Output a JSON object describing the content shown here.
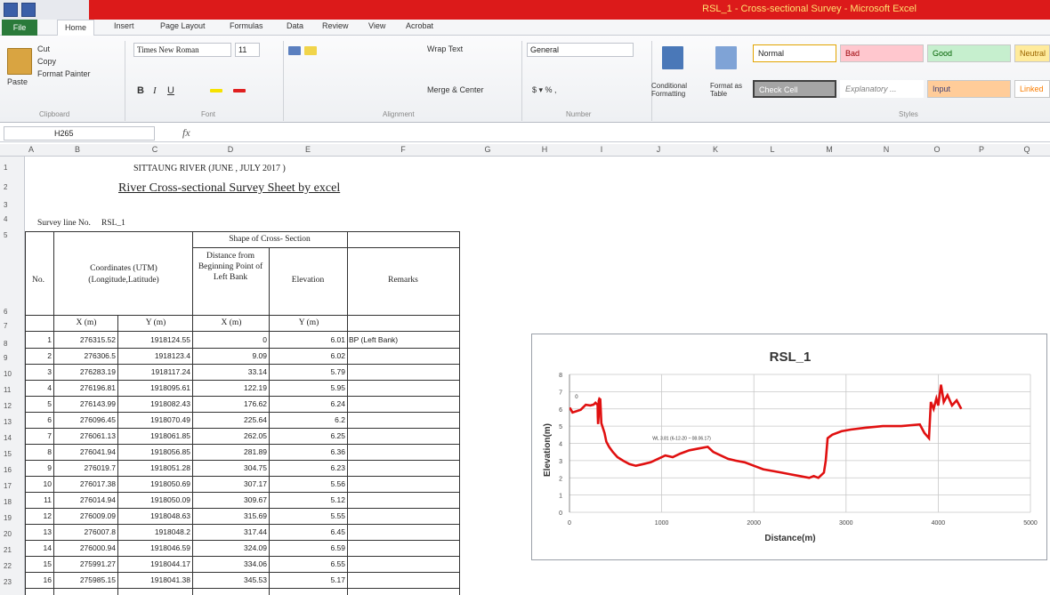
{
  "window": {
    "title": "RSL_1 - Cross-sectional Survey - Microsoft Excel"
  },
  "tabs": [
    "File",
    "Home",
    "Insert",
    "Page Layout",
    "Formulas",
    "Data",
    "Review",
    "View",
    "Acrobat"
  ],
  "ribbon": {
    "clipboard": {
      "paste": "Paste",
      "cut": "Cut",
      "copy": "Copy",
      "format_painter": "Format Painter",
      "label": "Clipboard"
    },
    "font": {
      "name": "Times New Roman",
      "size": "11",
      "label": "Font"
    },
    "alignment": {
      "wrap_text": "Wrap Text",
      "merge_center": "Merge & Center",
      "label": "Alignment"
    },
    "number": {
      "format": "General",
      "label": "Number"
    },
    "styles": {
      "conditional": "Conditional Formatting",
      "format_table": "Format as Table",
      "label": "Styles",
      "items": [
        "Normal",
        "Bad",
        "Good",
        "Neutral",
        "Check Cell",
        "Explanatory ...",
        "Input",
        "Linked"
      ]
    }
  },
  "formula_bar": {
    "name_box": "H265",
    "fx": "fx",
    "value": ""
  },
  "columns": [
    "A",
    "B",
    "C",
    "D",
    "E",
    "F",
    "G",
    "H",
    "I",
    "J",
    "K",
    "L",
    "M",
    "N",
    "O",
    "P",
    "Q"
  ],
  "rows": [
    "1",
    "2",
    "3",
    "4",
    "5",
    "6",
    "7",
    "8",
    "9",
    "10",
    "11",
    "12",
    "13",
    "14",
    "15",
    "16",
    "17",
    "18",
    "19",
    "20",
    "21",
    "22",
    "23"
  ],
  "sheet": {
    "title1": "SITTAUNG RIVER (JUNE , JULY 2017 )",
    "title2": "River Cross-sectional Survey Sheet by excel",
    "survey_line_label": "Survey line No.",
    "survey_line_value": "RSL_1",
    "headers": {
      "no": "No.",
      "coords": "Coordinates (UTM) (Longitude,Latitude)",
      "shape": "Shape of Cross- Section",
      "distance": "Distance from Beginning Point of Left Bank",
      "elevation": "Elevation",
      "remarks": "Remarks",
      "x_m": "X (m)",
      "y_m": "Y (m)",
      "dx_m": "X (m)",
      "ey_m": "Y (m)"
    },
    "data": [
      [
        "1",
        "276315.52",
        "1918124.55",
        "0",
        "6.01",
        "BP (Left Bank)"
      ],
      [
        "2",
        "276306.5",
        "1918123.4",
        "9.09",
        "6.02",
        ""
      ],
      [
        "3",
        "276283.19",
        "1918117.24",
        "33.14",
        "5.79",
        ""
      ],
      [
        "4",
        "276196.81",
        "1918095.61",
        "122.19",
        "5.95",
        ""
      ],
      [
        "5",
        "276143.99",
        "1918082.43",
        "176.62",
        "6.24",
        ""
      ],
      [
        "6",
        "276096.45",
        "1918070.49",
        "225.64",
        "6.2",
        ""
      ],
      [
        "7",
        "276061.13",
        "1918061.85",
        "262.05",
        "6.25",
        ""
      ],
      [
        "8",
        "276041.94",
        "1918056.85",
        "281.89",
        "6.36",
        ""
      ],
      [
        "9",
        "276019.7",
        "1918051.28",
        "304.75",
        "6.23",
        ""
      ],
      [
        "10",
        "276017.38",
        "1918050.69",
        "307.17",
        "5.56",
        ""
      ],
      [
        "11",
        "276014.94",
        "1918050.09",
        "309.67",
        "5.12",
        ""
      ],
      [
        "12",
        "276009.09",
        "1918048.63",
        "315.69",
        "5.55",
        ""
      ],
      [
        "13",
        "276007.8",
        "1918048.2",
        "317.44",
        "6.45",
        ""
      ],
      [
        "14",
        "276000.94",
        "1918046.59",
        "324.09",
        "6.59",
        ""
      ],
      [
        "15",
        "275991.27",
        "1918044.17",
        "334.06",
        "6.55",
        ""
      ],
      [
        "16",
        "275985.15",
        "1918041.38",
        "345.53",
        "5.17",
        ""
      ]
    ]
  },
  "chart_data": {
    "type": "line",
    "title": "RSL_1",
    "xlabel": "Distance(m)",
    "ylabel": "Elevation(m)",
    "xlim": [
      0,
      5000
    ],
    "ylim": [
      0,
      8
    ],
    "xticks": [
      "0",
      "1000",
      "2000",
      "3000",
      "4000",
      "5000"
    ],
    "yticks": [
      "0",
      "1",
      "2",
      "3",
      "4",
      "5",
      "6",
      "7",
      "8"
    ],
    "start_label": "0",
    "annotation": "WL 3.81 (6-12-20 ~ 08.06.17)",
    "color": "#e01010",
    "series": [
      {
        "x": [
          0,
          9,
          33,
          122,
          177,
          226,
          262,
          282,
          305,
          307,
          310,
          316,
          317,
          324,
          334,
          346,
          380,
          400,
          430,
          470,
          520,
          580,
          650,
          720,
          800,
          880,
          960,
          1040,
          1120,
          1200,
          1300,
          1400,
          1500,
          1560,
          1640,
          1720,
          1800,
          1900,
          2000,
          2100,
          2200,
          2300,
          2400,
          2500,
          2600,
          2650,
          2700,
          2760,
          2780,
          2800,
          2850,
          2950,
          3050,
          3200,
          3400,
          3600,
          3800,
          3850,
          3900,
          3920,
          3950,
          3980,
          4000,
          4030,
          4060,
          4100,
          4150,
          4200,
          4250
        ],
        "y": [
          6.01,
          6.02,
          5.79,
          5.95,
          6.24,
          6.2,
          6.25,
          6.36,
          6.23,
          5.56,
          5.12,
          5.55,
          6.45,
          6.59,
          6.55,
          5.17,
          4.6,
          4.1,
          3.8,
          3.5,
          3.2,
          3.0,
          2.8,
          2.7,
          2.8,
          2.9,
          3.1,
          3.3,
          3.2,
          3.4,
          3.6,
          3.7,
          3.8,
          3.5,
          3.3,
          3.1,
          3.0,
          2.9,
          2.7,
          2.5,
          2.4,
          2.3,
          2.2,
          2.1,
          2.0,
          2.1,
          2.0,
          2.3,
          3.0,
          4.3,
          4.5,
          4.7,
          4.8,
          4.9,
          5.0,
          5.0,
          5.1,
          4.6,
          4.3,
          6.4,
          6.0,
          6.6,
          6.2,
          7.4,
          6.4,
          6.8,
          6.2,
          6.5,
          6.0
        ]
      }
    ]
  }
}
